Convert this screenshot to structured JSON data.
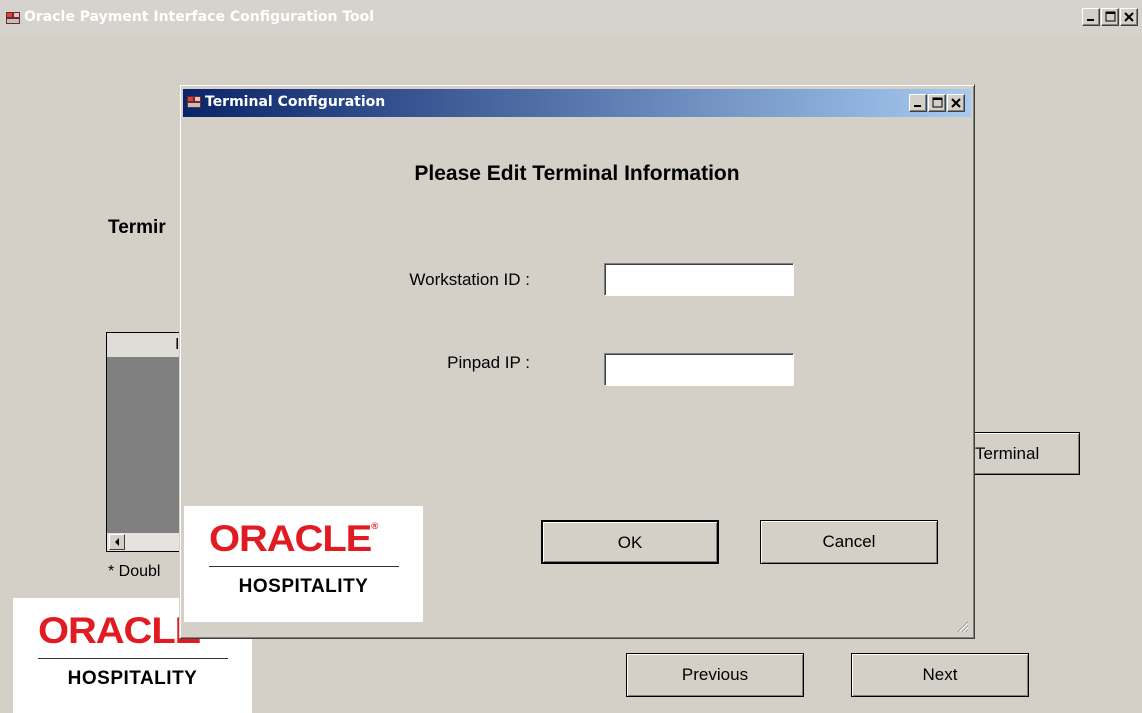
{
  "main_window": {
    "title": "Oracle Payment Interface Configuration Tool",
    "section_label": "Termir",
    "table_header": "I",
    "hint": "* Doubl",
    "terminal_button": "Terminal",
    "previous_button": "Previous",
    "next_button": "Next"
  },
  "dialog": {
    "title": "Terminal Configuration",
    "heading": "Please Edit Terminal Information",
    "workstation_label": "Workstation ID :",
    "workstation_value": "",
    "pinpad_label": "Pinpad IP :",
    "pinpad_value": "",
    "ok_button": "OK",
    "cancel_button": "Cancel"
  },
  "logo": {
    "brand": "ORACLE",
    "subtitle": "HOSPITALITY",
    "brand_color": "#e11b22"
  },
  "colors": {
    "window_bg": "#d4d0c8",
    "dialog_title_start": "#0a246a",
    "dialog_title_end": "#a6caf0"
  }
}
